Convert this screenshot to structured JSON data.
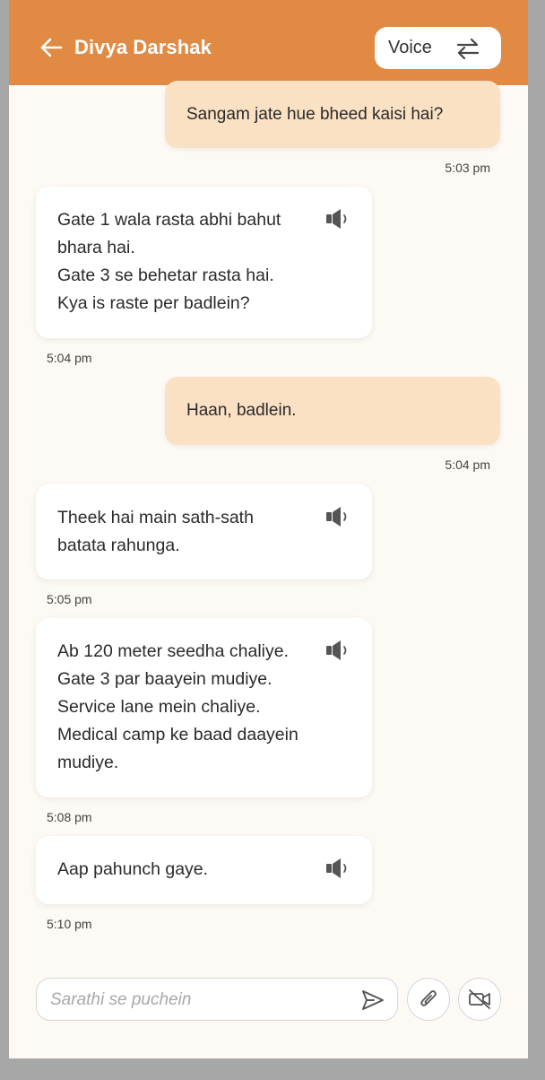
{
  "header": {
    "title": "Divya Darshak",
    "mode_label": "Voice",
    "back_icon": "arrow-left-icon",
    "swap_icon": "swap-arrows-icon"
  },
  "messages": [
    {
      "sender": "user",
      "lines": [
        "Sangam jate hue bheed kaisi hai?"
      ],
      "time": "5:03 pm"
    },
    {
      "sender": "bot",
      "lines": [
        "Gate 1 wala rasta abhi bahut",
        "bhara hai.",
        "Gate 3 se behetar rasta hai.",
        "Kya is raste per badlein?"
      ],
      "time": "5:04 pm"
    },
    {
      "sender": "user",
      "lines": [
        "Haan, badlein."
      ],
      "time": "5:04 pm"
    },
    {
      "sender": "bot",
      "lines": [
        "Theek hai main sath-sath",
        "batata rahunga."
      ],
      "time": "5:05 pm"
    },
    {
      "sender": "bot",
      "lines": [
        "Ab 120 meter seedha chaliye.",
        "Gate 3 par baayein mudiye.",
        "Service lane mein chaliye.",
        "Medical camp ke baad daayein",
        "mudiye."
      ],
      "time": "5:08 pm"
    },
    {
      "sender": "bot",
      "lines": [
        "Aap pahunch gaye."
      ],
      "time": "5:10 pm"
    }
  ],
  "composer": {
    "placeholder": "Sarathi se puchein",
    "send_icon": "send-icon",
    "attach_icon": "paperclip-icon",
    "video_icon": "video-off-icon"
  },
  "colors": {
    "header": "#e08a43",
    "user_bubble": "#fae1c4",
    "bot_bubble": "#ffffff",
    "background": "#fdf9f4"
  }
}
